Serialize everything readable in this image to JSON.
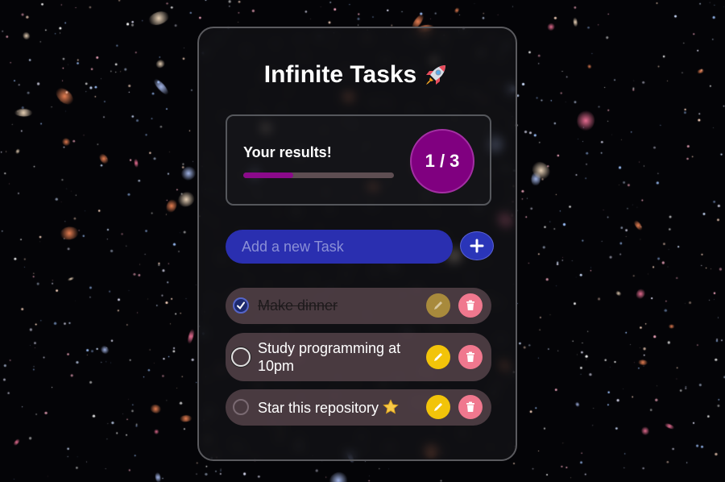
{
  "app": {
    "title": "Infinite Tasks"
  },
  "results": {
    "label": "Your results!",
    "completed": 1,
    "total": 3,
    "counter_text": "1 / 3",
    "progress_fraction": 0.333
  },
  "new_task": {
    "placeholder": "Add a new Task",
    "value": ""
  },
  "tasks": [
    {
      "text": "Make dinner",
      "completed": true
    },
    {
      "text": "Study programming at 10pm",
      "completed": false
    },
    {
      "text": "Star this repository",
      "completed": false
    }
  ],
  "colors": {
    "accent_purple": "#800080",
    "input_blue": "#2a2fb0",
    "edit_yellow": "#f2c40a",
    "delete_pink": "#f0788e"
  },
  "icons": [
    "rocket-icon",
    "plus-icon",
    "check-icon",
    "pencil-icon",
    "trash-icon",
    "star-icon"
  ]
}
